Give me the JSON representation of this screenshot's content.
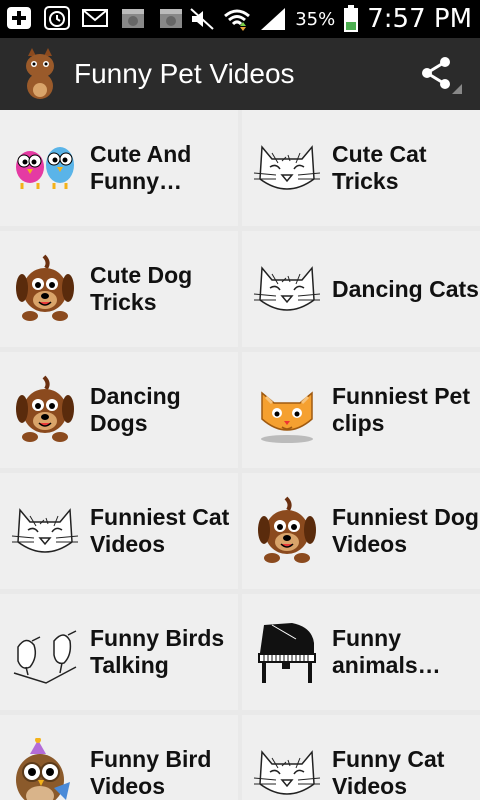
{
  "status": {
    "battery": "35%",
    "time": "7:57 PM"
  },
  "actionbar": {
    "title": "Funny Pet Videos"
  },
  "tiles": [
    {
      "label1": "Cute And",
      "label2": "Funny…",
      "icon": "birds-icon"
    },
    {
      "label1": "Cute Cat",
      "label2": "Tricks",
      "icon": "cat-sketch-icon"
    },
    {
      "label1": "Cute Dog",
      "label2": "Tricks",
      "icon": "dog-icon"
    },
    {
      "label1": "Dancing Cats",
      "label2": "",
      "icon": "cat-sketch-icon"
    },
    {
      "label1": "Dancing",
      "label2": "Dogs",
      "icon": "dog-icon"
    },
    {
      "label1": "Funniest Pet",
      "label2": "clips",
      "icon": "orange-cat-icon"
    },
    {
      "label1": "Funniest Cat",
      "label2": "Videos",
      "icon": "cat-sketch-icon"
    },
    {
      "label1": "Funniest Dog",
      "label2": "Videos",
      "icon": "dog-icon"
    },
    {
      "label1": "Funny Birds",
      "label2": "Talking",
      "icon": "birds-sketch-icon"
    },
    {
      "label1": "Funny",
      "label2": "animals…",
      "icon": "piano-icon"
    },
    {
      "label1": "Funny Bird",
      "label2": "Videos",
      "icon": "owl-icon"
    },
    {
      "label1": "Funny Cat",
      "label2": "Videos",
      "icon": "cat-sketch-icon"
    }
  ]
}
